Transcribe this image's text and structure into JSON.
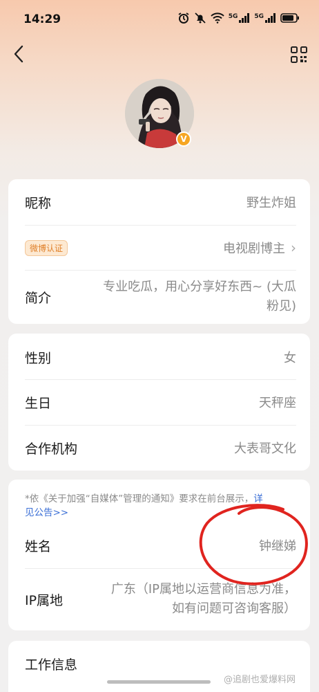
{
  "status_bar": {
    "time": "14:29",
    "net1": "5G",
    "net2": "5G"
  },
  "nav": {
    "back_icon": "chevron-left-icon",
    "qr_icon": "qr-code-icon"
  },
  "profile": {
    "verify_mark": "V"
  },
  "section1": {
    "nickname_label": "昵称",
    "nickname_value": "野生炸姐",
    "verify_badge": "微博认证",
    "verify_value": "电视剧博主",
    "bio_label": "简介",
    "bio_value_line1": "专业吃瓜，用心分享好东西~ (大瓜",
    "bio_value_line2": "粉见)"
  },
  "section2": {
    "gender_label": "性别",
    "gender_value": "女",
    "birthday_label": "生日",
    "birthday_value": "天秤座",
    "agency_label": "合作机构",
    "agency_value": "大表哥文化"
  },
  "section3": {
    "notice_text": "*依《关于加强“自媒体”管理的通知》要求在前台展示，",
    "notice_link_part1": "详",
    "notice_link_part2": "见公告>>",
    "name_label": "姓名",
    "name_value": "钟继娣",
    "ip_label": "IP属地",
    "ip_value_line1": "广东（IP属地以运营商信息为准，",
    "ip_value_line2": "如有问题可咨询客服）"
  },
  "section4": {
    "work_label": "工作信息"
  },
  "watermark": "@追剧也爱爆料网",
  "colors": {
    "accent_orange": "#f6a623",
    "link_blue": "#3b6fd6",
    "annotation_red": "#e0241f"
  }
}
